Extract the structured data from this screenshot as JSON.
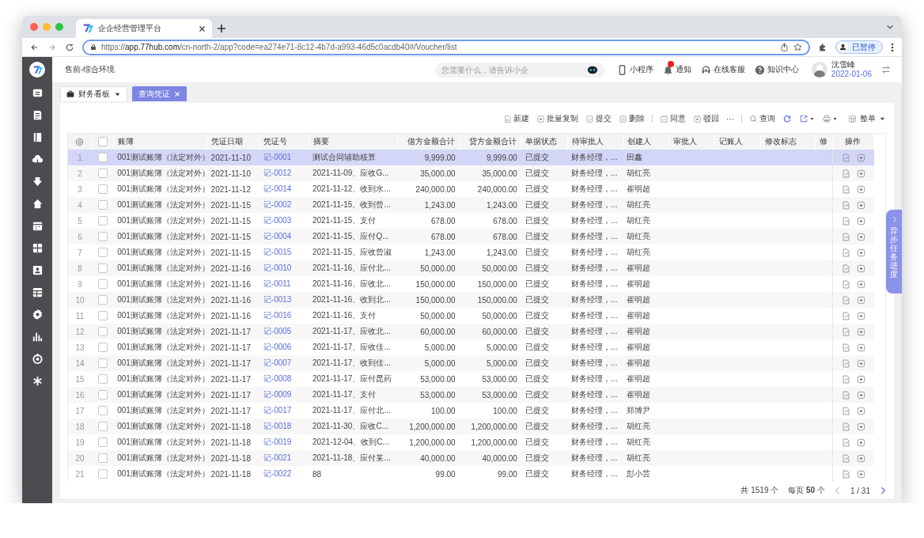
{
  "browser": {
    "tab_title": "企企经营管理平台",
    "url": "https://**app.77hub.com**/cn-north-2/app?code=ea274e71-8c12-4b7d-a993-46d5c0acdb40#/Voucher/list",
    "profile_label": "已暂停"
  },
  "header": {
    "environment": "售前-综合环境",
    "search": {
      "placeholder": "您需要什么，请告诉小企"
    },
    "links": [
      {
        "kind": "phone",
        "label": "小程序",
        "badge": false
      },
      {
        "kind": "bell",
        "label": "通知",
        "badge": true
      },
      {
        "kind": "headset",
        "label": "在线客服",
        "badge": false
      },
      {
        "kind": "help",
        "label": "知识中心",
        "badge": false
      }
    ],
    "user": {
      "name": "沈雪峰",
      "date": "2022-01-06"
    }
  },
  "page_tabs": [
    {
      "kind": "dropdown",
      "label": "财务看板",
      "selected": false
    },
    {
      "kind": "closable",
      "label": "查询凭证",
      "selected": true
    }
  ],
  "toolbar": [
    {
      "kind": "new",
      "label": "新建"
    },
    {
      "kind": "copy",
      "label": "批量复制"
    },
    {
      "kind": "submit",
      "label": "提交"
    },
    {
      "kind": "delete",
      "label": "删除"
    },
    {
      "kind": "separator"
    },
    {
      "kind": "approve",
      "label": "同意"
    },
    {
      "kind": "reject",
      "label": "驳回"
    },
    {
      "kind": "more",
      "label": "···"
    },
    {
      "kind": "separator"
    },
    {
      "kind": "search",
      "label": "查询"
    },
    {
      "kind": "refresh"
    },
    {
      "kind": "export"
    },
    {
      "kind": "print"
    },
    {
      "kind": "layout",
      "label": "整单"
    }
  ],
  "table": {
    "select_all_checked": false,
    "columns": [
      "账簿",
      "凭证日期",
      "凭证号",
      "摘要",
      "借方金额合计",
      "贷方金额合计",
      "单据状态",
      "待审批人",
      "创建人",
      "审批人",
      "记账人",
      "修改标志",
      "修",
      "操作"
    ],
    "rows": [
      {
        "index": "1",
        "selected": true,
        "checked": false,
        "cells": [
          "001测试账簿（法定对外）",
          "2021-11-10",
          "记-0001",
          "测试合同辅助核算",
          "9,999.00",
          "9,999.00",
          "已提交",
          "财务经理，...",
          "田鑫"
        ]
      },
      {
        "index": "2",
        "selected": false,
        "checked": false,
        "cells": [
          "001测试账簿（法定对外）",
          "2021-11-10",
          "记-0012",
          "2021-11-09、应收G...",
          "35,000.00",
          "35,000.00",
          "已提交",
          "财务经理，...",
          "胡红亮"
        ]
      },
      {
        "index": "3",
        "selected": false,
        "checked": false,
        "cells": [
          "001测试账簿（法定对外）",
          "2021-11-12",
          "记-0014",
          "2021-11-12、收到水...",
          "240,000.00",
          "240,000.00",
          "已提交",
          "财务经理，...",
          "崔明超"
        ]
      },
      {
        "index": "4",
        "selected": false,
        "checked": false,
        "cells": [
          "001测试账簿（法定对外）",
          "2021-11-15",
          "记-0002",
          "2021-11-15、收到曾...",
          "1,243.00",
          "1,243.00",
          "已提交",
          "财务经理，...",
          "胡红亮"
        ]
      },
      {
        "index": "5",
        "selected": false,
        "checked": false,
        "cells": [
          "001测试账簿（法定对外）",
          "2021-11-15",
          "记-0003",
          "2021-11-15、支付",
          "678.00",
          "678.00",
          "已提交",
          "财务经理，...",
          "胡红亮"
        ]
      },
      {
        "index": "6",
        "selected": false,
        "checked": false,
        "cells": [
          "001测试账簿（法定对外）",
          "2021-11-15",
          "记-0004",
          "2021-11-15、应付Q...",
          "678.00",
          "678.00",
          "已提交",
          "财务经理，...",
          "胡红亮"
        ]
      },
      {
        "index": "7",
        "selected": false,
        "checked": false,
        "cells": [
          "001测试账簿（法定对外）",
          "2021-11-15",
          "记-0015",
          "2021-11-15、应收曾淑",
          "1,243.00",
          "1,243.00",
          "已提交",
          "财务经理，...",
          "胡红亮"
        ]
      },
      {
        "index": "8",
        "selected": false,
        "checked": false,
        "cells": [
          "001测试账簿（法定对外）",
          "2021-11-16",
          "记-0010",
          "2021-11-16、应付北...",
          "50,000.00",
          "50,000.00",
          "已提交",
          "财务经理，...",
          "崔明超"
        ]
      },
      {
        "index": "9",
        "selected": false,
        "checked": false,
        "cells": [
          "001测试账簿（法定对外）",
          "2021-11-16",
          "记-0011",
          "2021-11-16、应收北...",
          "150,000.00",
          "150,000.00",
          "已提交",
          "财务经理，...",
          "崔明超"
        ]
      },
      {
        "index": "10",
        "selected": false,
        "checked": false,
        "cells": [
          "001测试账簿（法定对外）",
          "2021-11-16",
          "记-0013",
          "2021-11-16、收到北...",
          "150,000.00",
          "150,000.00",
          "已提交",
          "财务经理，...",
          "崔明超"
        ]
      },
      {
        "index": "11",
        "selected": false,
        "checked": false,
        "cells": [
          "001测试账簿（法定对外）",
          "2021-11-16",
          "记-0016",
          "2021-11-16、支付",
          "50,000.00",
          "50,000.00",
          "已提交",
          "财务经理，...",
          "崔明超"
        ]
      },
      {
        "index": "12",
        "selected": false,
        "checked": false,
        "cells": [
          "001测试账簿（法定对外）",
          "2021-11-17",
          "记-0005",
          "2021-11-17、应收北...",
          "60,000.00",
          "60,000.00",
          "已提交",
          "财务经理，...",
          "崔明超"
        ]
      },
      {
        "index": "13",
        "selected": false,
        "checked": false,
        "cells": [
          "001测试账簿（法定对外）",
          "2021-11-17",
          "记-0006",
          "2021-11-17、应收佳...",
          "5,000.00",
          "5,000.00",
          "已提交",
          "财务经理，...",
          "崔明超"
        ]
      },
      {
        "index": "14",
        "selected": false,
        "checked": false,
        "cells": [
          "001测试账簿（法定对外）",
          "2021-11-17",
          "记-0007",
          "2021-11-17、收到佳...",
          "5,000.00",
          "5,000.00",
          "已提交",
          "财务经理，...",
          "崔明超"
        ]
      },
      {
        "index": "15",
        "selected": false,
        "checked": false,
        "cells": [
          "001测试账簿（法定对外）",
          "2021-11-17",
          "记-0008",
          "2021-11-17、应付昆药",
          "53,000.00",
          "53,000.00",
          "已提交",
          "财务经理，...",
          "崔明超"
        ]
      },
      {
        "index": "16",
        "selected": false,
        "checked": false,
        "cells": [
          "001测试账簿（法定对外）",
          "2021-11-17",
          "记-0009",
          "2021-11-17、支付",
          "53,000.00",
          "53,000.00",
          "已提交",
          "财务经理，...",
          "崔明超"
        ]
      },
      {
        "index": "17",
        "selected": false,
        "checked": false,
        "cells": [
          "001测试账簿（法定对外）",
          "2021-11-17",
          "记-0017",
          "2021-11-17、应付北...",
          "100.00",
          "100.00",
          "已提交",
          "财务经理，...",
          "郑博尹"
        ]
      },
      {
        "index": "18",
        "selected": false,
        "checked": false,
        "cells": [
          "001测试账簿（法定对外）",
          "2021-11-18",
          "记-0018",
          "2021-11-30、应收C...",
          "1,200,000.00",
          "1,200,000.00",
          "已提交",
          "财务经理，...",
          "胡红亮"
        ]
      },
      {
        "index": "19",
        "selected": false,
        "checked": false,
        "cells": [
          "001测试账簿（法定对外）",
          "2021-11-18",
          "记-0019",
          "2021-12-04、收到C...",
          "1,200,000.00",
          "1,200,000.00",
          "已提交",
          "财务经理，...",
          "胡红亮"
        ]
      },
      {
        "index": "20",
        "selected": false,
        "checked": false,
        "cells": [
          "001测试账簿（法定对外）",
          "2021-11-18",
          "记-0021",
          "2021-11-18、应付某...",
          "40,000.00",
          "40,000.00",
          "已提交",
          "财务经理，...",
          "胡红亮"
        ]
      },
      {
        "index": "21",
        "selected": false,
        "checked": false,
        "cells": [
          "001测试账簿（法定对外）",
          "2021-11-18",
          "记-0022",
          "88",
          "99.00",
          "99.00",
          "已提交",
          "财务经理，...",
          "彭小芸"
        ]
      }
    ]
  },
  "pagination": {
    "total": "共 1519 个",
    "page_size": "每页 **50** 个",
    "page": "1 / 31"
  },
  "task_panel": {
    "label": "异步任务进度"
  }
}
